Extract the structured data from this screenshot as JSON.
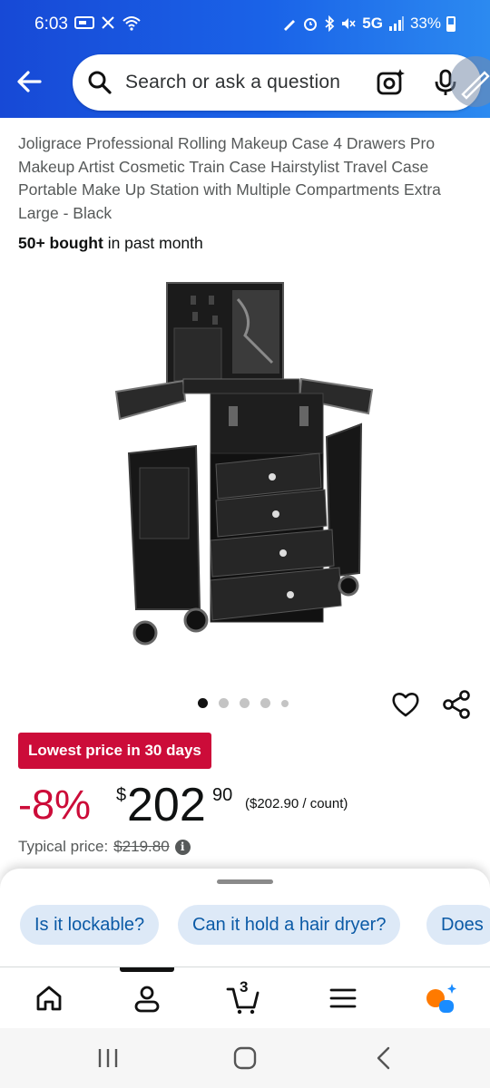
{
  "status_bar": {
    "time": "6:03",
    "network": "5G",
    "battery": "33%",
    "left_icons": [
      "carrier-icon",
      "missed-call-icon",
      "wifi-icon"
    ],
    "right_icons": [
      "pen-icon",
      "alarm-icon",
      "bluetooth-icon",
      "mute-icon",
      "signal-icon",
      "battery-icon"
    ]
  },
  "header": {
    "search_placeholder": "Search or ask a question"
  },
  "product": {
    "title": "Joligrace Professional Rolling Makeup Case 4 Drawers Pro Makeup Artist Cosmetic Train Case Hairstylist Travel Case Portable Make Up Station with Multiple Compartments Extra Large - Black",
    "bought_bold": "50+ bought",
    "bought_rest": " in past month",
    "image_count": 5,
    "active_image": 1
  },
  "pricing": {
    "deal_badge": "Lowest price in 30 days",
    "discount": "-8%",
    "currency": "$",
    "price_whole": "202",
    "price_fraction": "90",
    "unit_price": "($202.90 / count)",
    "typical_label": "Typical price:",
    "typical_price": "$219.80",
    "info_glyph": "i"
  },
  "questions": {
    "chips": [
      "Is it lockable?",
      "Can it hold a hair dryer?",
      "Does"
    ]
  },
  "bottom_nav": {
    "cart_count": "3",
    "items": [
      "home-icon",
      "account-icon",
      "cart-icon",
      "menu-icon",
      "rufus-icon"
    ],
    "active": "account-icon"
  },
  "colors": {
    "header_blue": "#1a5ce6",
    "deal_red": "#cc0c39",
    "chip_bg": "#dde9f7",
    "chip_text": "#0b5aa6"
  }
}
